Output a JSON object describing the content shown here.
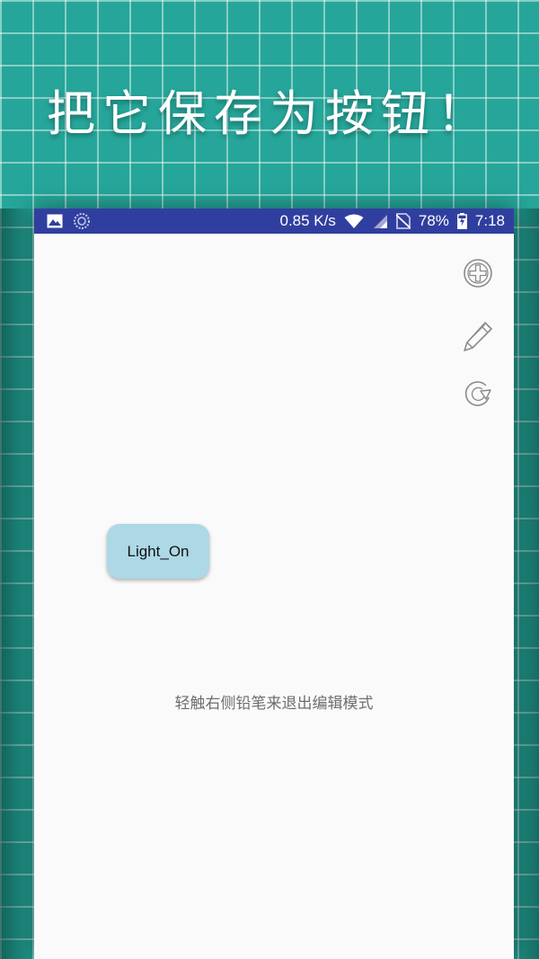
{
  "promo": {
    "headline": "把它保存为按钮！"
  },
  "status_bar": {
    "speed": "0.85 K/s",
    "battery": "78%",
    "time": "7:18",
    "icons": [
      "image-icon",
      "loading-icon",
      "wifi-icon",
      "signal-icon",
      "no-sim-icon",
      "battery-charging-icon"
    ]
  },
  "toolbar": {
    "icons": [
      "add-circle-icon",
      "pencil-icon",
      "refresh-icon"
    ]
  },
  "canvas": {
    "button_label": "Light_On",
    "hint": "轻触右侧铅笔来退出编辑模式"
  },
  "colors": {
    "background": "#26a69a",
    "status_bar": "#303f9f",
    "button_bg": "#add8e6",
    "screen_bg": "#fafafa"
  }
}
